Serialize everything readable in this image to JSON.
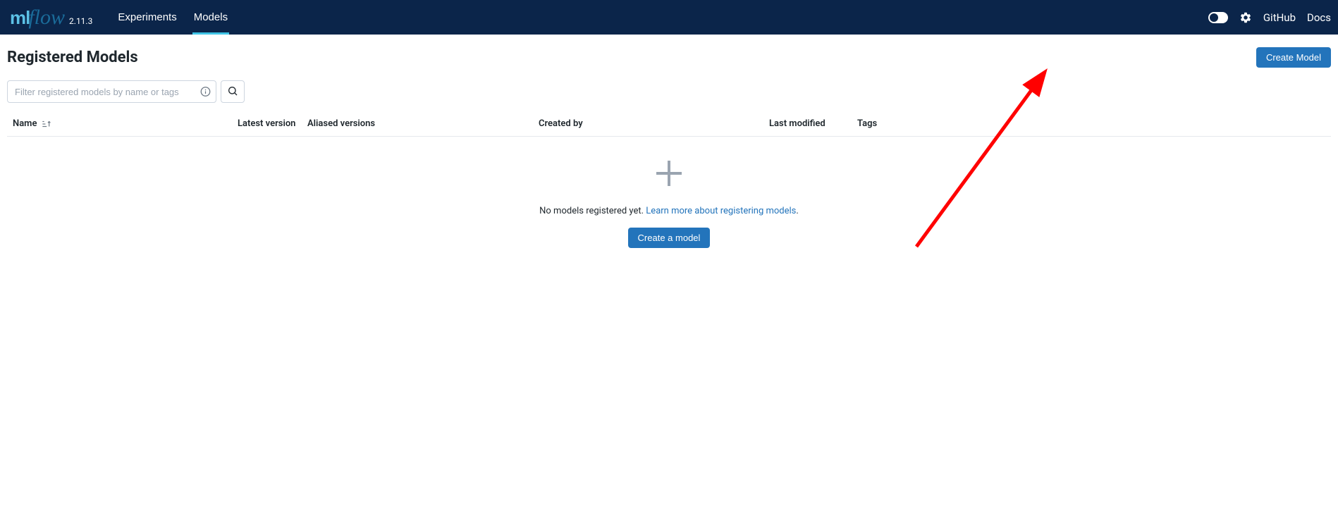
{
  "header": {
    "logo_version": "2.11.3",
    "nav": {
      "experiments": "Experiments",
      "models": "Models"
    },
    "links": {
      "github": "GitHub",
      "docs": "Docs"
    }
  },
  "page": {
    "title": "Registered Models",
    "create_model_btn": "Create Model"
  },
  "filter": {
    "placeholder": "Filter registered models by name or tags"
  },
  "table": {
    "headers": {
      "name": "Name",
      "latest_version": "Latest version",
      "aliased_versions": "Aliased versions",
      "created_by": "Created by",
      "last_modified": "Last modified",
      "tags": "Tags"
    }
  },
  "empty_state": {
    "text_prefix": "No models registered yet. ",
    "link_text": "Learn more about registering models",
    "text_suffix": ".",
    "create_btn": "Create a model"
  }
}
